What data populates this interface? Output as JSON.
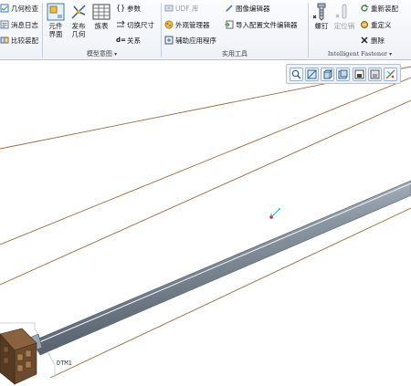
{
  "ribbon": {
    "col1": [
      "几何检查",
      "消息日志",
      "比较装配"
    ],
    "large_buttons": [
      {
        "line1": "元件",
        "line2": "界面"
      },
      {
        "line1": "发布",
        "line2": "几何"
      },
      {
        "line1": "族表",
        "line2": ""
      }
    ],
    "col3": [
      "参数",
      "切换尺寸",
      "关系"
    ],
    "col4": [
      "UDF 库",
      "外观管理器",
      "辅助应用程序"
    ],
    "col5": [
      "图像编辑器",
      "导入配置文件编辑器"
    ],
    "fastener_large": [
      {
        "label": "螺钉",
        "disabled": false
      },
      {
        "label": "定位销",
        "disabled": true
      }
    ],
    "col7": [
      "重新装配",
      "重定义",
      "删除"
    ],
    "groups": {
      "model_intent": "模型意图",
      "utilities": "实用工具",
      "intelligent_fastener": "Intelligent Fastener"
    }
  },
  "viewport": {
    "datum_label": "DTM1"
  },
  "colors": {
    "rail_line": "#9a6a3c",
    "shaft_mid": "#8b96a3",
    "datum_cyan": "#1fb6d4",
    "datum_red": "#d93030",
    "block_brown": "#6b4a2e"
  }
}
